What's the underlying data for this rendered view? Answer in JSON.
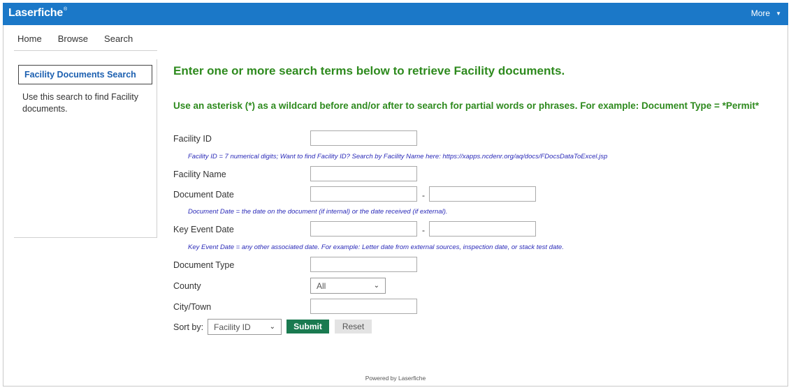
{
  "header": {
    "logo": "Laserfiche",
    "logo_tm": "®",
    "more_label": "More",
    "brand_color": "#1b78c8"
  },
  "nav": {
    "items": [
      {
        "label": "Home"
      },
      {
        "label": "Browse"
      },
      {
        "label": "Search"
      }
    ]
  },
  "sidebar": {
    "active_label": "Facility Documents Search",
    "description": "Use this search to find Facility documents."
  },
  "main": {
    "heading": "Enter one or more search terms below to retrieve Facility documents.",
    "subheading": "Use an asterisk (*) as a wildcard before and/or after to search for partial words or phrases. For example: Document Type = *Permit*",
    "heading_color": "#2e8a1e"
  },
  "form": {
    "facility_id": {
      "label": "Facility ID",
      "value": "",
      "hint": "Facility ID = 7 numerical digits; Want to find Facility ID? Search by Facility Name here: https://xapps.ncdenr.org/aq/docs/FDocsDataToExcel.jsp"
    },
    "facility_name": {
      "label": "Facility Name",
      "value": ""
    },
    "document_date": {
      "label": "Document Date",
      "from": "",
      "to": "",
      "separator": "-",
      "hint": "Document Date = the date on the document (if internal) or the date received (if external)."
    },
    "key_event_date": {
      "label": "Key Event Date",
      "from": "",
      "to": "",
      "separator": "-",
      "hint": "Key Event Date = any other associated date. For example: Letter date from external sources, inspection date, or stack test date."
    },
    "document_type": {
      "label": "Document Type",
      "value": ""
    },
    "county": {
      "label": "County",
      "selected": "All"
    },
    "city_town": {
      "label": "City/Town",
      "value": ""
    },
    "sort_by": {
      "label": "Sort by:",
      "selected": "Facility ID"
    },
    "submit_label": "Submit",
    "reset_label": "Reset",
    "submit_color": "#1a7a50"
  },
  "footer": {
    "text": "Powered by Laserfiche"
  }
}
